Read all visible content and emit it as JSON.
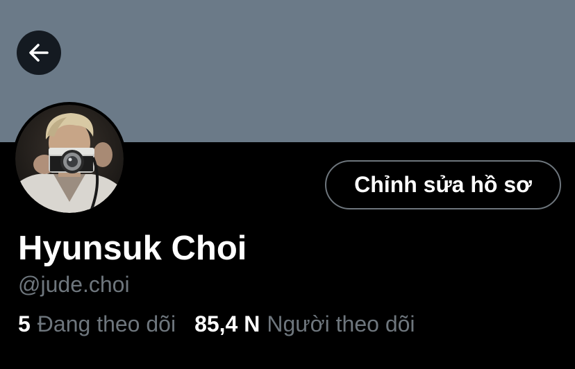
{
  "header": {
    "back_icon": "arrow-left-icon",
    "banner_color": "#6b7a88"
  },
  "profile": {
    "avatar": "profile-photo",
    "edit_button_label": "Chỉnh sửa hồ sơ",
    "display_name": "Hyunsuk Choi",
    "handle": "@jude.choi",
    "following": {
      "count": "5",
      "label": "Đang theo dõi"
    },
    "followers": {
      "count": "85,4 N",
      "label": "Người theo dõi"
    }
  },
  "colors": {
    "background": "#000000",
    "secondary_text": "#6e767d",
    "primary_text": "#ffffff"
  }
}
